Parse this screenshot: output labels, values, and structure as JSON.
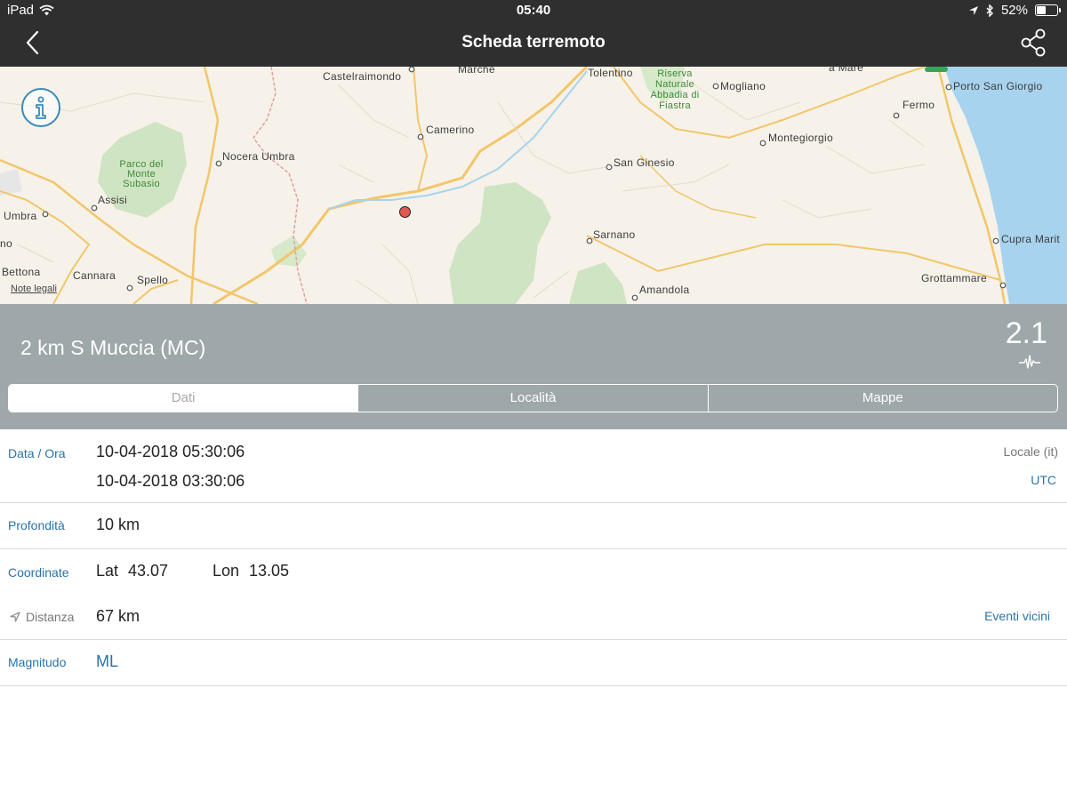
{
  "status_bar": {
    "device": "iPad",
    "time": "05:40",
    "battery": "52%",
    "battery_level": 0.52
  },
  "nav": {
    "title": "Scheda terremoto",
    "back_icon": "chevron-left-icon",
    "share_icon": "share-icon"
  },
  "map": {
    "legal": "Note legali",
    "labels": {
      "castelraimondo": "Castelraimondo",
      "marche": "Marche",
      "tolentino": "Tolentino",
      "riserva": "Riserva Naturale Abbadia di Fiastra",
      "mogliano": "Mogliano",
      "a_mare": "a Mare",
      "porto_san_giorgio": "Porto San Giorgio",
      "fermo": "Fermo",
      "camerino": "Camerino",
      "montegiorgio": "Montegiorgio",
      "nocera_umbra": "Nocera Umbra",
      "parco": "Parco del Monte Subasio",
      "san_ginesio": "San Ginesio",
      "assisi": "Assisi",
      "umbra": "Umbra",
      "sarnano": "Sarnano",
      "cupra": "Cupra Marit",
      "no": "no",
      "bettona": "Bettona",
      "cannara": "Cannara",
      "spello": "Spello",
      "grottammare": "Grottammare",
      "amandola": "Amandola"
    }
  },
  "event": {
    "place": "2 km S Muccia (MC)",
    "magnitude": "2.1",
    "tabs": [
      "Dati",
      "Località",
      "Mappe"
    ],
    "active_tab": "Dati"
  },
  "details": {
    "date_label": "Data / Ora",
    "date_local": "10-04-2018 05:30:06",
    "date_utc": "10-04-2018 03:30:06",
    "local_label": "Locale (it)",
    "utc_label": "UTC",
    "depth_label": "Profondità",
    "depth_value": "10 km",
    "coord_label": "Coordinate",
    "lat_label": "Lat",
    "lat_value": "43.07",
    "lon_label": "Lon",
    "lon_value": "13.05",
    "distance_label": "Distanza",
    "distance_value": "67 km",
    "nearby_label": "Eventi vicini",
    "magnitude_label": "Magnitudo",
    "magnitude_type": "ML"
  },
  "colors": {
    "bar": "#2f2f2f",
    "band": "#9ea7aa",
    "accent": "#2b73a8",
    "quake": "#e05a50",
    "sea": "#a7d3ee"
  }
}
